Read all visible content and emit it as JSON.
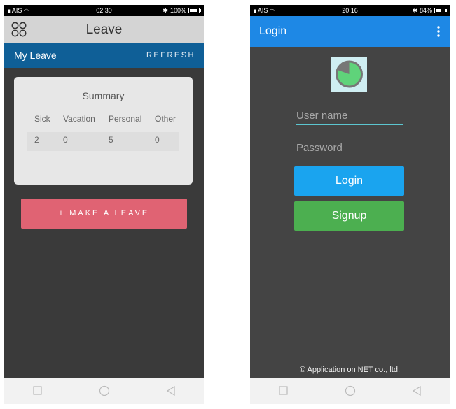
{
  "left_screen": {
    "status": {
      "carrier": "AIS",
      "time": "02:30",
      "battery": "100%",
      "battery_level": 1.0
    },
    "header": {
      "title": "Leave"
    },
    "tab": {
      "label": "My Leave",
      "refresh": "REFRESH"
    },
    "summary": {
      "title": "Summary",
      "columns": [
        "Sick",
        "Vacation",
        "Personal",
        "Other"
      ],
      "values": [
        "2",
        "0",
        "5",
        "0"
      ]
    },
    "make_leave_label": "+ MAKE A LEAVE"
  },
  "right_screen": {
    "status": {
      "carrier": "AIS",
      "time": "20:16",
      "battery": "84%",
      "battery_level": 0.84
    },
    "header": {
      "title": "Login"
    },
    "username_placeholder": "User name",
    "password_placeholder": "Password",
    "login_label": "Login",
    "signup_label": "Signup",
    "footer": "© Application on NET co., ltd."
  },
  "icons": {
    "apps": "apps-icon",
    "menu": "more-vert-icon",
    "logo": "pie-logo-icon",
    "nav": [
      "square-icon",
      "circle-icon",
      "back-triangle-icon"
    ]
  },
  "colors": {
    "leave_tabbar": "#0f5f97",
    "make_leave": "#e06373",
    "login_header": "#1e88e5",
    "login_button": "#1aa4ef",
    "signup_button": "#4caf50",
    "logo_green": "#5fd37a"
  }
}
